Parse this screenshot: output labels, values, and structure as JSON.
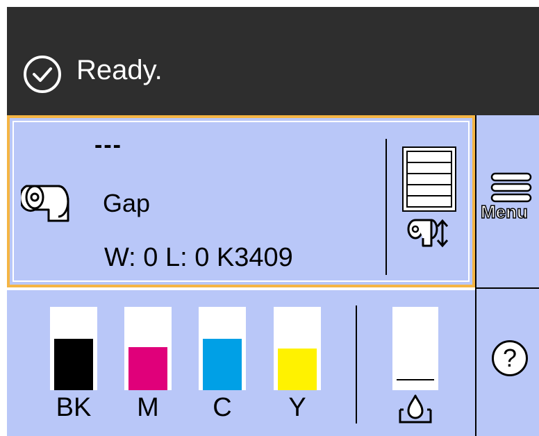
{
  "status": {
    "text": "Ready.",
    "icon": "check-circle-icon"
  },
  "media": {
    "line1": "---",
    "type": "Gap",
    "size": "W: 0 L: 0 K3409",
    "roll_icon": "paper-roll-icon",
    "stack_icon": "paper-stack-icon",
    "feed_icon": "feed-adjust-icon"
  },
  "menu": {
    "label": "Menu",
    "icon": "hamburger-icon"
  },
  "inks": [
    {
      "label": "BK",
      "color": "#000000",
      "level": 0.74
    },
    {
      "label": "M",
      "color": "#e0007a",
      "level": 0.62
    },
    {
      "label": "C",
      "color": "#00a0e6",
      "level": 0.74
    },
    {
      "label": "Y",
      "color": "#fff200",
      "level": 0.6
    }
  ],
  "maintenance": {
    "icon": "maintenance-box-icon",
    "level": 0.13
  },
  "help": {
    "label": "?"
  },
  "colors": {
    "panel": "#b9c7f8",
    "status_bar": "#2e2e2e",
    "focus_border": "#f5b544"
  }
}
